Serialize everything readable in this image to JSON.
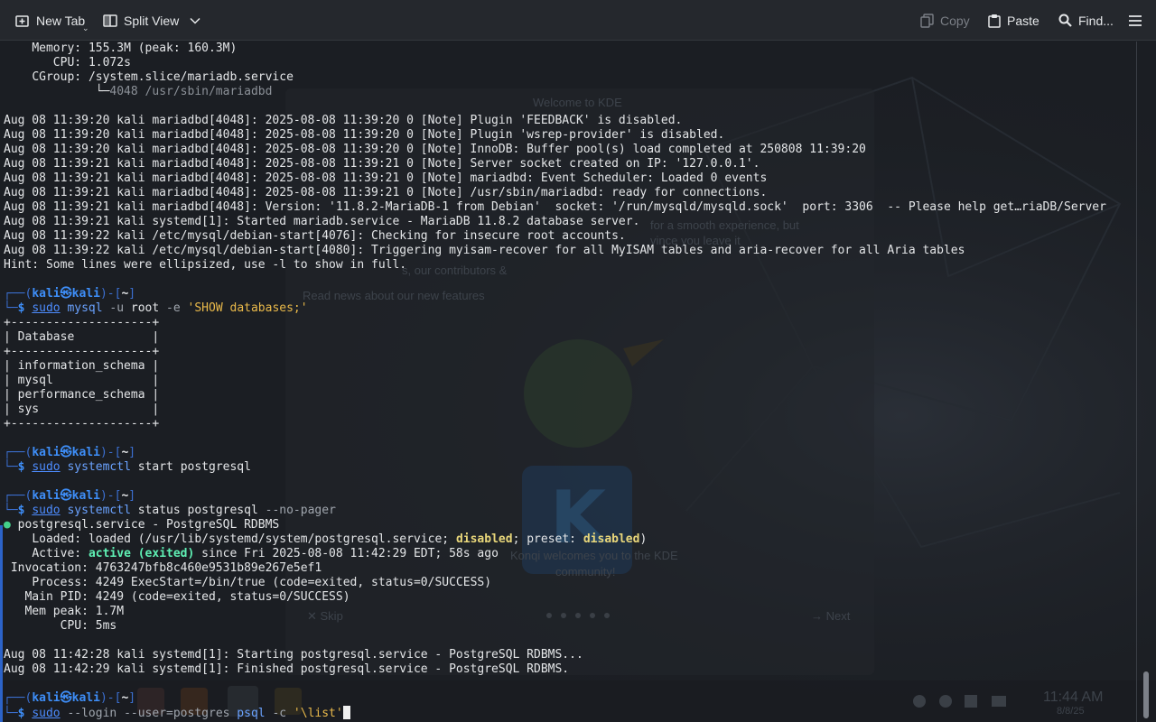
{
  "toolbar": {
    "new_tab": "New Tab",
    "split_view": "Split View",
    "copy": "Copy",
    "paste": "Paste",
    "find": "Find..."
  },
  "background": {
    "popup_lines": [
      "Welcome to KDE",
      "for a smooth experience, but",
      "vince you leave it",
      "s, our contributors &",
      "Read news about our new features",
      "Konqi welcomes you to the KDE",
      "community!"
    ],
    "skip": "Skip",
    "next": "Next",
    "clock_time": "11:44 AM",
    "clock_date": "8/8/25"
  },
  "terminal": {
    "status1": {
      "memory_label": "Memory:",
      "memory_value": "155.3M (peak: 160.3M)",
      "cpu_label": "CPU:",
      "cpu_value": "1.072s",
      "cgroup_label": "CGroup:",
      "cgroup_value": "/system.slice/mariadb.service",
      "tree_branch": "└─",
      "tree_value": "4048 /usr/sbin/mariadbd"
    },
    "log1": [
      "Aug 08 11:39:20 kali mariadbd[4048]: 2025-08-08 11:39:20 0 [Note] Plugin 'FEEDBACK' is disabled.",
      "Aug 08 11:39:20 kali mariadbd[4048]: 2025-08-08 11:39:20 0 [Note] Plugin 'wsrep-provider' is disabled.",
      "Aug 08 11:39:20 kali mariadbd[4048]: 2025-08-08 11:39:20 0 [Note] InnoDB: Buffer pool(s) load completed at 250808 11:39:20",
      "Aug 08 11:39:21 kali mariadbd[4048]: 2025-08-08 11:39:21 0 [Note] Server socket created on IP: '127.0.0.1'.",
      "Aug 08 11:39:21 kali mariadbd[4048]: 2025-08-08 11:39:21 0 [Note] mariadbd: Event Scheduler: Loaded 0 events",
      "Aug 08 11:39:21 kali mariadbd[4048]: 2025-08-08 11:39:21 0 [Note] /usr/sbin/mariadbd: ready for connections.",
      "Aug 08 11:39:21 kali mariadbd[4048]: Version: '11.8.2-MariaDB-1 from Debian'  socket: '/run/mysqld/mysqld.sock'  port: 3306  -- Please help get…riaDB/Server",
      "Aug 08 11:39:21 kali systemd[1]: Started mariadb.service - MariaDB 11.8.2 database server.",
      "Aug 08 11:39:22 kali /etc/mysql/debian-start[4076]: Checking for insecure root accounts.",
      "Aug 08 11:39:22 kali /etc/mysql/debian-start[4080]: Triggering myisam-recover for all MyISAM tables and aria-recover for all Aria tables",
      "Hint: Some lines were ellipsized, use -l to show in full."
    ],
    "prompt": {
      "top_open": "┌──(",
      "user": "kali",
      "at": "㉿",
      "host": "kali",
      "mid": ")-[",
      "dir": "~",
      "close": "]",
      "bottom": "└─",
      "dollar": "$"
    },
    "cmd1": {
      "sudo": "sudo",
      "prog": "mysql",
      "flag1": "-u",
      "arg1": "root",
      "flag2": "-e",
      "arg2": "'SHOW databases;'"
    },
    "db_table": [
      "+--------------------+",
      "| Database           |",
      "+--------------------+",
      "| information_schema |",
      "| mysql              |",
      "| performance_schema |",
      "| sys                |",
      "+--------------------+"
    ],
    "cmd2": {
      "sudo": "sudo",
      "prog": "systemctl",
      "args": "start postgresql"
    },
    "cmd3": {
      "sudo": "sudo",
      "prog": "systemctl",
      "args": "status postgresql",
      "flag": "--no-pager"
    },
    "pg_status": {
      "bullet": "●",
      "title": "postgresql.service - PostgreSQL RDBMS",
      "loaded_label": "Loaded:",
      "loaded_pre": "loaded (/usr/lib/systemd/system/postgresql.service;",
      "loaded_state1": "disabled",
      "loaded_mid": "; preset:",
      "loaded_state2": "disabled",
      "loaded_end": ")",
      "active_label": "Active:",
      "active_state": "active (exited)",
      "active_rest": "since Fri 2025-08-08 11:42:29 EDT; 58s ago",
      "invocation_label": "Invocation:",
      "invocation_value": "4763247bfb8c460e9531b89e267e5ef1",
      "process_label": "Process:",
      "process_value": "4249 ExecStart=/bin/true (code=exited, status=0/SUCCESS)",
      "mainpid_label": "Main PID:",
      "mainpid_value": "4249 (code=exited, status=0/SUCCESS)",
      "mempeak_label": "Mem peak:",
      "mempeak_value": "1.7M",
      "cpu_label": "CPU:",
      "cpu_value": "5ms"
    },
    "log2": [
      "Aug 08 11:42:28 kali systemd[1]: Starting postgresql.service - PostgreSQL RDBMS...",
      "Aug 08 11:42:29 kali systemd[1]: Finished postgresql.service - PostgreSQL RDBMS."
    ],
    "cmd4": {
      "sudo": "sudo",
      "args": "--login --user=postgres",
      "prog": "psql",
      "flag": "-c",
      "arg": "'\\list'"
    }
  },
  "colors": {
    "background": "#1b1e23",
    "toolbar": "#25282d",
    "prompt_blue": "#3e8ef8",
    "command_blue": "#4d8cff",
    "string_yellow": "#e9b94a",
    "active_green": "#5ff0b4",
    "disabled_yellow": "#e9d77a"
  },
  "icons": {
    "new_tab": "tab-new-icon",
    "split_view": "split-view-icon",
    "copy": "copy-icon",
    "paste": "paste-icon",
    "find": "search-icon",
    "menu": "hamburger-menu-icon"
  }
}
